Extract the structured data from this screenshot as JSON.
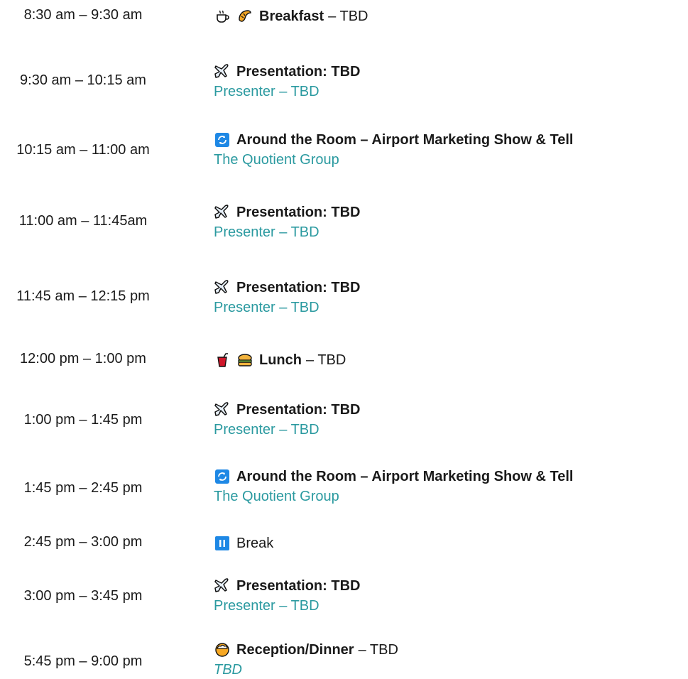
{
  "agenda": [
    {
      "time": "8:30 am – 9:30 am",
      "icons": [
        "coffee-icon",
        "croissant-icon"
      ],
      "title": "Breakfast",
      "suffix": "– TBD",
      "bold": true,
      "subtitle": ""
    },
    {
      "time": "9:30 am – 10:15 am",
      "icons": [
        "airplane-icon"
      ],
      "title": "Presentation: TBD",
      "suffix": "",
      "bold": true,
      "subtitle": "Presenter – TBD"
    },
    {
      "time": "10:15 am – 11:00 am",
      "icons": [
        "repeat-icon"
      ],
      "title": "Around the Room – Airport Marketing Show & Tell",
      "suffix": "",
      "bold": true,
      "subtitle": "The Quotient Group"
    },
    {
      "time": "11:00 am – 11:45am",
      "icons": [
        "airplane-icon"
      ],
      "title": "Presentation: TBD",
      "suffix": "",
      "bold": true,
      "subtitle": "Presenter – TBD"
    },
    {
      "time": "11:45 am – 12:15 pm",
      "icons": [
        "airplane-icon"
      ],
      "title": "Presentation: TBD",
      "suffix": "",
      "bold": true,
      "subtitle": "Presenter – TBD"
    },
    {
      "time": "12:00 pm – 1:00 pm",
      "icons": [
        "drink-icon",
        "sandwich-icon"
      ],
      "title": "Lunch",
      "suffix": "– TBD",
      "bold": true,
      "subtitle": ""
    },
    {
      "time": "1:00 pm – 1:45 pm",
      "icons": [
        "airplane-icon"
      ],
      "title": "Presentation: TBD",
      "suffix": "",
      "bold": true,
      "subtitle": "Presenter – TBD"
    },
    {
      "time": "1:45 pm – 2:45 pm",
      "icons": [
        "repeat-icon"
      ],
      "title": "Around the Room – Airport Marketing Show & Tell",
      "suffix": "",
      "bold": true,
      "subtitle": "The Quotient Group"
    },
    {
      "time": "2:45 pm – 3:00 pm",
      "icons": [
        "pause-icon"
      ],
      "title": "Break",
      "suffix": "",
      "bold": false,
      "subtitle": ""
    },
    {
      "time": "3:00 pm – 3:45 pm",
      "icons": [
        "airplane-icon"
      ],
      "title": "Presentation: TBD",
      "suffix": "",
      "bold": true,
      "subtitle": "Presenter – TBD"
    },
    {
      "time": "5:45 pm – 9:00 pm",
      "icons": [
        "beer-icon"
      ],
      "title": "Reception/Dinner",
      "suffix": "– TBD",
      "bold": true,
      "subtitle": "TBD",
      "subtitle_italic": true
    }
  ],
  "colors": {
    "accent": "#2b9aa0",
    "text": "#1a1a1a",
    "icon_blue": "#1e88e5"
  }
}
